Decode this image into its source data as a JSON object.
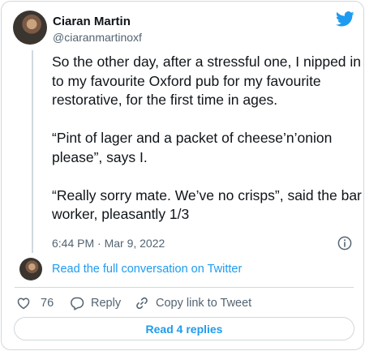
{
  "author": {
    "name": "Ciaran Martin",
    "handle": "@ciaranmartinoxf"
  },
  "tweet": {
    "paragraphs": [
      "So the other day, after a stressful one, I nipped in to my favourite Oxford pub for my favourite restorative, for the first time in ages.",
      "“Pint of lager and a packet of cheese’n’onion please”, says I.",
      "“Really sorry mate. We’ve no crisps”, said the bar worker, pleasantly 1/3"
    ],
    "timestamp": "6:44 PM · Mar 9, 2022"
  },
  "conversation_link": "Read the full conversation on Twitter",
  "actions": {
    "like_count": "76",
    "reply_label": "Reply",
    "copy_link_label": "Copy link to Tweet"
  },
  "replies_button_label": "Read 4 replies",
  "icons": {
    "brand": "twitter-bird-icon",
    "info": "info-icon",
    "like": "heart-icon",
    "reply": "speech-bubble-icon",
    "copy": "link-icon"
  },
  "colors": {
    "accent": "#1d9bf0",
    "text": "#0f1419",
    "secondary_text": "#536471",
    "border": "#cfd9de"
  }
}
